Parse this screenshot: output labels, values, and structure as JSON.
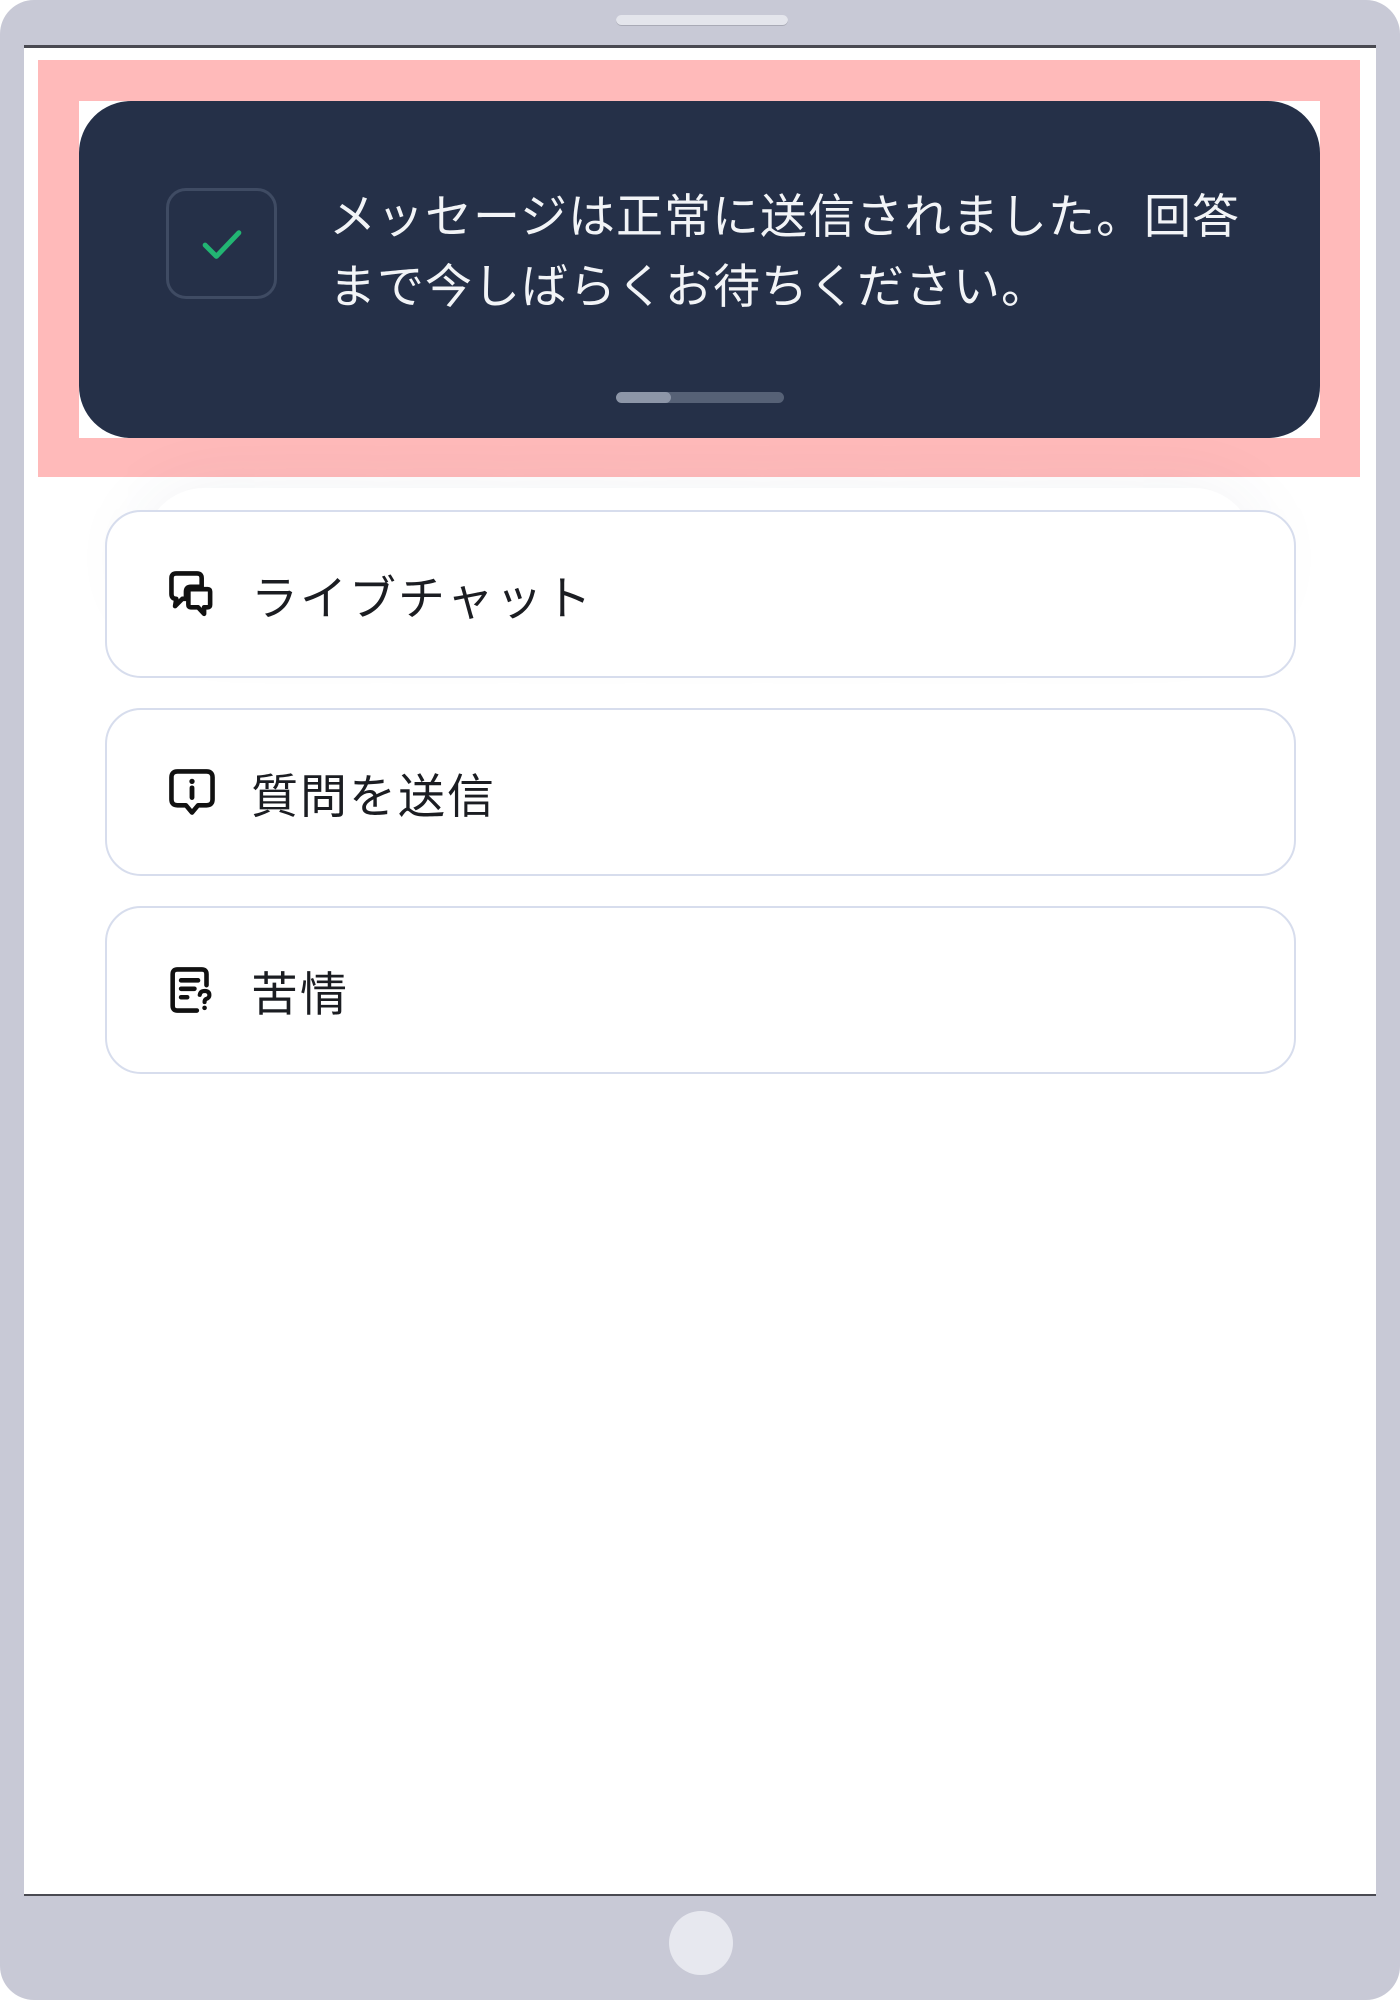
{
  "device": {
    "frame_color": "#c8c9d6"
  },
  "highlight_color": "#ffbaba",
  "toast": {
    "message": "メッセージは正常に送信されました。回答まで今しばらくお待ちください。",
    "icon": "check-icon",
    "background": "#253048",
    "check_color": "#22b573",
    "progress": 0.33
  },
  "menu": {
    "items": [
      {
        "label": "ライブチャット",
        "icon": "chat-bubbles-icon"
      },
      {
        "label": "質問を送信",
        "icon": "info-bubble-icon"
      },
      {
        "label": "苦情",
        "icon": "document-question-icon"
      }
    ]
  }
}
